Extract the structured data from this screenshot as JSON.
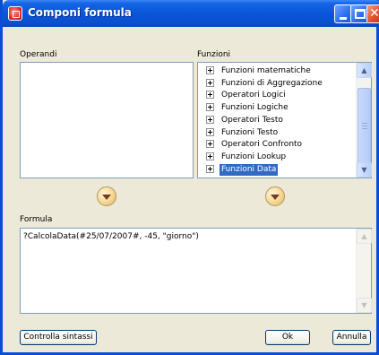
{
  "window": {
    "title": "Componi formula"
  },
  "operandi": {
    "label": "Operandi",
    "items": []
  },
  "funzioni": {
    "label": "Funzioni",
    "items": [
      {
        "label": "Funzioni matematiche",
        "selected": false
      },
      {
        "label": "Funzioni di Aggregazione",
        "selected": false
      },
      {
        "label": "Operatori Logici",
        "selected": false
      },
      {
        "label": "Funzioni Logiche",
        "selected": false
      },
      {
        "label": "Operatori Testo",
        "selected": false
      },
      {
        "label": "Funzioni Testo",
        "selected": false
      },
      {
        "label": "Operatori Confronto",
        "selected": false
      },
      {
        "label": "Funzioni Lookup",
        "selected": false
      },
      {
        "label": "Funzioni Data",
        "selected": true
      }
    ]
  },
  "formula": {
    "label": "Formula",
    "value": "?CalcolaData(#25/07/2007#, -45, \"giorno\")"
  },
  "buttons": {
    "check_syntax": "Controlla sintassi",
    "ok": "Ok",
    "cancel": "Annulla"
  },
  "colors": {
    "title_bar": "#0a50cf",
    "selection": "#316ac5",
    "dialog_bg": "#ece9d8"
  }
}
